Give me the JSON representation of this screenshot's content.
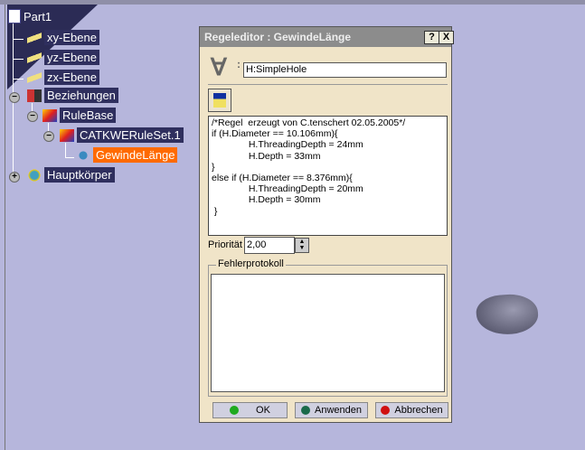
{
  "tree": {
    "root": "Part1",
    "items": [
      {
        "label": "xy-Ebene"
      },
      {
        "label": "yz-Ebene"
      },
      {
        "label": "zx-Ebene"
      },
      {
        "label": "Beziehungen"
      },
      {
        "label": "RuleBase"
      },
      {
        "label": "CATKWERuleSet.1"
      },
      {
        "label": "GewindeLänge",
        "selected": true
      },
      {
        "label": "Hauptkörper"
      }
    ]
  },
  "dialog": {
    "title": "Regeleditor : GewindeLänge",
    "help": "?",
    "close": "X",
    "variable": "H:SimpleHole",
    "code": [
      "/*Regel  erzeugt von C.tenschert 02.05.2005*/",
      "if (H.Diameter == 10.106mm){",
      "              H.ThreadingDepth = 24mm",
      "              H.Depth = 33mm",
      "}",
      "else if (H.Diameter == 8.376mm){",
      "              H.ThreadingDepth = 20mm",
      "              H.Depth = 30mm",
      " }"
    ],
    "priority_label": "Priorität",
    "priority": "2,00",
    "log_label": "Fehlerprotokoll",
    "log": "",
    "ok": "OK",
    "apply": "Anwenden",
    "cancel": "Abbrechen"
  },
  "colors": {
    "ok": "#1faa1f",
    "apply": "#1a6a4a",
    "cancel": "#d01010",
    "selected": "#ff6a00"
  }
}
